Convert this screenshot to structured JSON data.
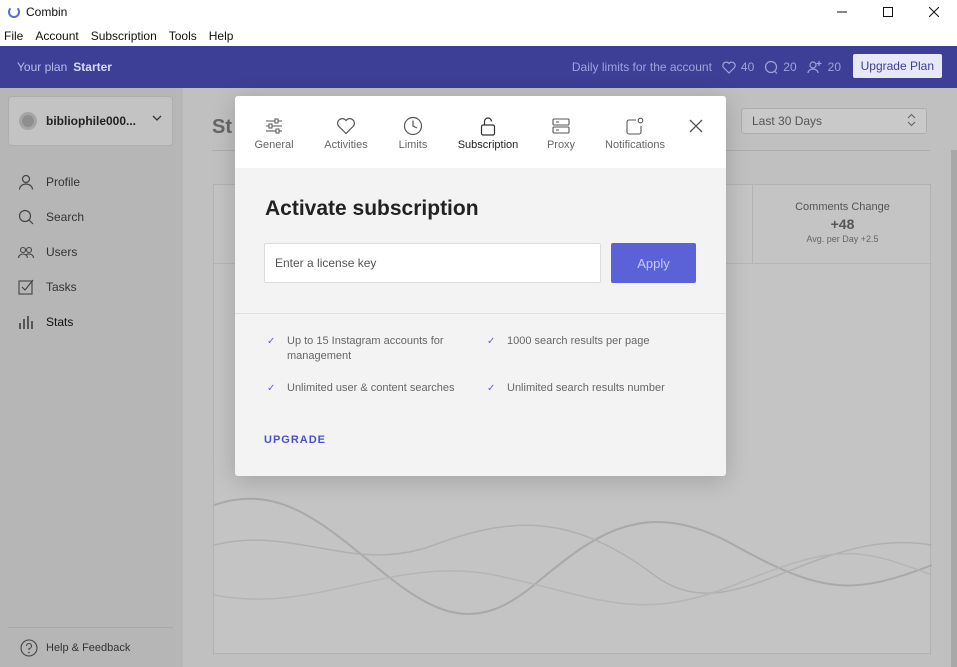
{
  "window": {
    "title": "Combin",
    "minimize": "—",
    "maximize": "☐",
    "close": "✕"
  },
  "menu": [
    "File",
    "Account",
    "Subscription",
    "Tools",
    "Help"
  ],
  "planbar": {
    "label": "Your plan",
    "plan": "Starter",
    "limits_label": "Daily limits for the account",
    "likes": "40",
    "comments": "20",
    "follows": "20",
    "upgrade_label": "Upgrade Plan"
  },
  "sidebar": {
    "account_name": "bibliophile000...",
    "items": [
      {
        "label": "Profile",
        "icon": "user-icon"
      },
      {
        "label": "Search",
        "icon": "search-icon"
      },
      {
        "label": "Users",
        "icon": "users-icon"
      },
      {
        "label": "Tasks",
        "icon": "tasks-icon"
      },
      {
        "label": "Stats",
        "icon": "stats-icon"
      }
    ],
    "help": "Help & Feedback"
  },
  "main": {
    "title": "St",
    "date_range": "Last 30 Days",
    "metric": {
      "title": "Comments Change",
      "value": "+48",
      "sub": "Avg. per Day +2.5"
    }
  },
  "modal": {
    "tabs": [
      {
        "label": "General",
        "icon": "sliders-icon"
      },
      {
        "label": "Activities",
        "icon": "heart-icon"
      },
      {
        "label": "Limits",
        "icon": "clock-icon"
      },
      {
        "label": "Subscription",
        "icon": "unlock-icon",
        "active": true
      },
      {
        "label": "Proxy",
        "icon": "server-icon"
      },
      {
        "label": "Notifications",
        "icon": "notification-icon"
      }
    ],
    "heading": "Activate subscription",
    "input_placeholder": "Enter a license key",
    "apply_label": "Apply",
    "features": [
      "Up to 15 Instagram accounts for management",
      "1000 search results per page",
      "Unlimited user & content searches",
      "Unlimited search results number"
    ],
    "upgrade_label": "UPGRADE",
    "accent_color": "#5b62d8"
  }
}
